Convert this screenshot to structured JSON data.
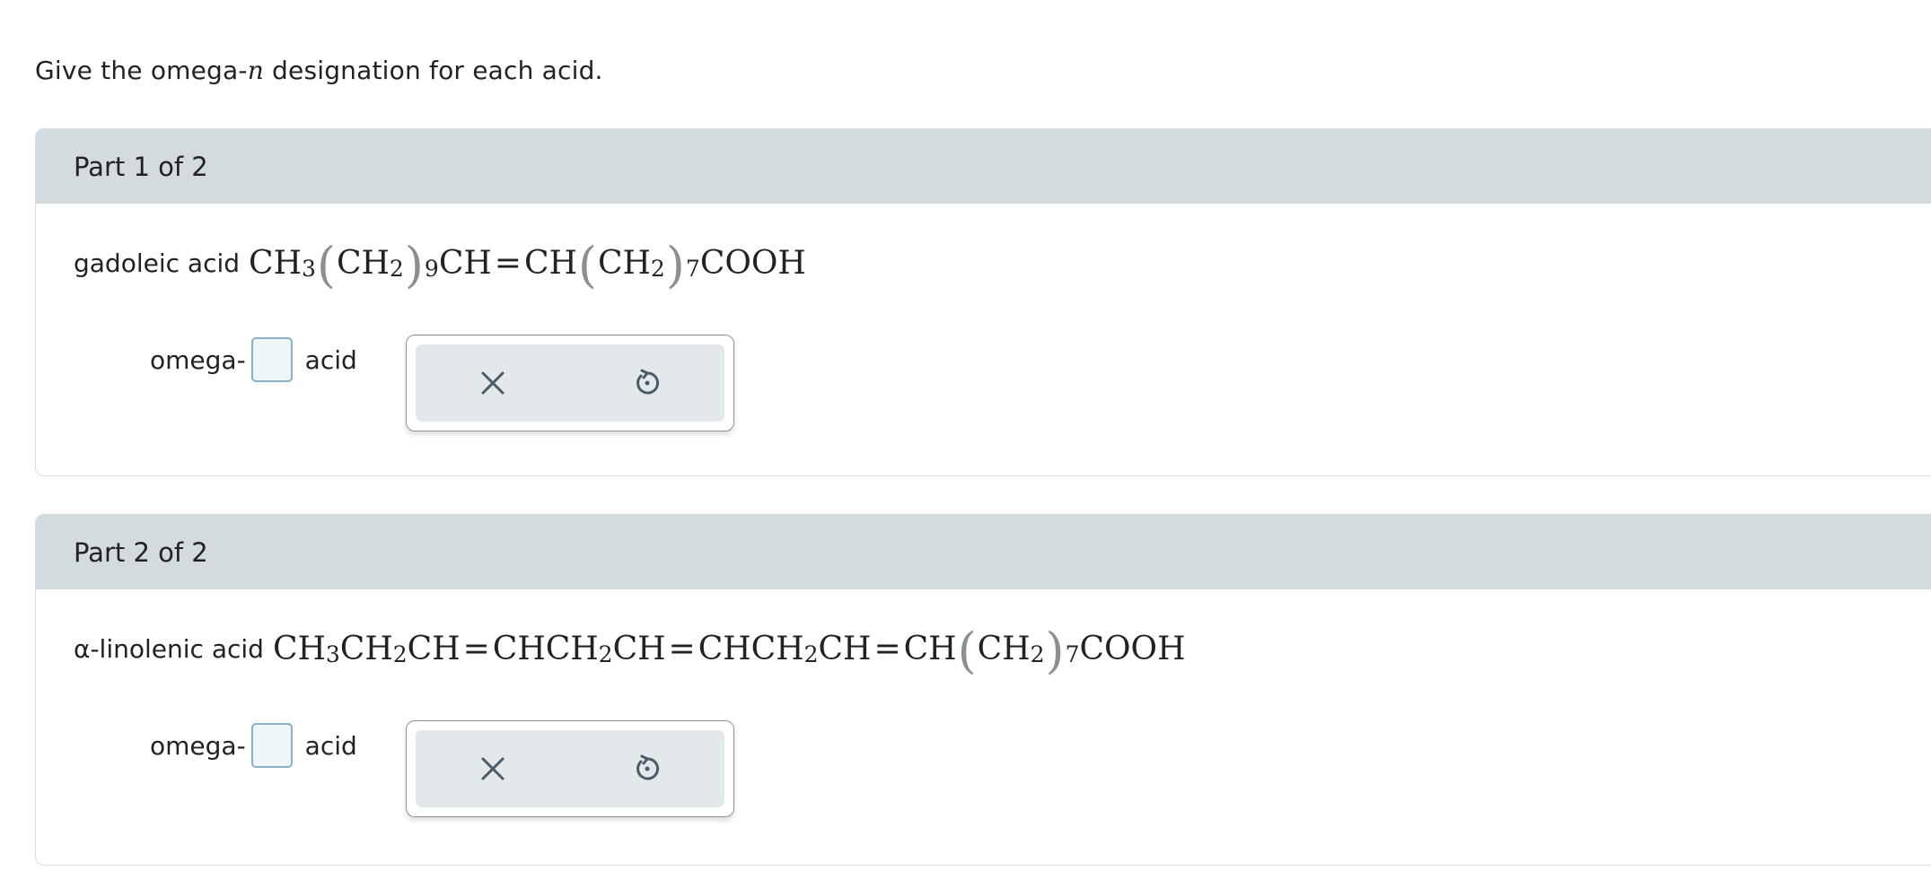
{
  "question": {
    "prefix": "Give the omega-",
    "italic": "n",
    "suffix": " designation for each acid."
  },
  "parts": [
    {
      "header": "Part 1 of 2",
      "acid_name": "gadoleic acid",
      "answer_prefix": "omega-",
      "answer_value": "",
      "answer_suffix": "acid"
    },
    {
      "header": "Part 2 of 2",
      "acid_name": "α-linolenic acid",
      "answer_prefix": "omega-",
      "answer_value": "",
      "answer_suffix": "acid"
    }
  ],
  "icons": {
    "clear": "close-icon",
    "reset": "undo-icon"
  },
  "colors": {
    "header_bg": "#d4dbdf",
    "input_border": "#8aaec2",
    "toolbox_bg": "#e3e8eb",
    "icon": "#4a5a66"
  }
}
